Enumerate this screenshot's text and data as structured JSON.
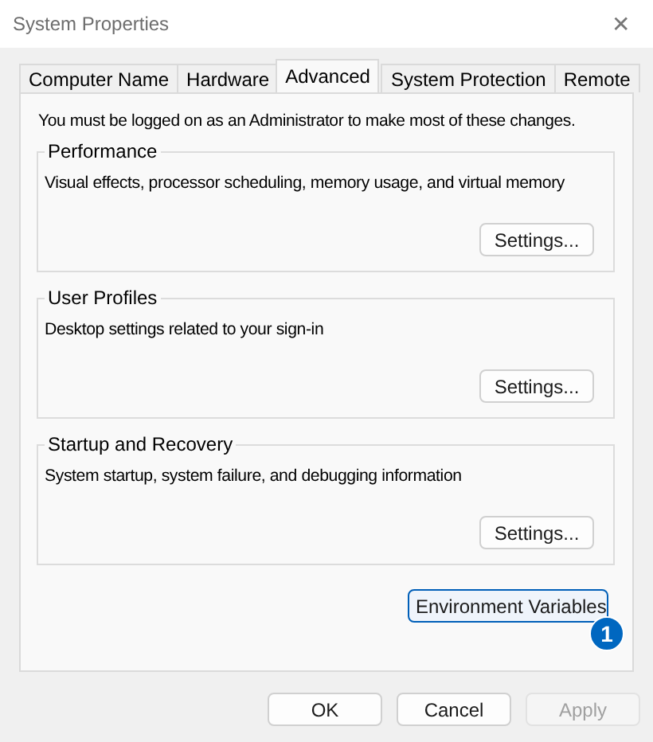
{
  "window": {
    "title": "System Properties",
    "close": "✕"
  },
  "tabs": [
    {
      "label": "Computer Name",
      "selected": false
    },
    {
      "label": "Hardware",
      "selected": false
    },
    {
      "label": "Advanced",
      "selected": true
    },
    {
      "label": "System Protection",
      "selected": false
    },
    {
      "label": "Remote",
      "selected": false
    }
  ],
  "notice": "You must be logged on as an Administrator to make most of these changes.",
  "groups": [
    {
      "title": "Performance",
      "description": "Visual effects, processor scheduling, memory usage, and virtual memory",
      "button": "Settings..."
    },
    {
      "title": "User Profiles",
      "description": "Desktop settings related to your sign-in",
      "button": "Settings..."
    },
    {
      "title": "Startup and Recovery",
      "description": "System startup, system failure, and debugging information",
      "button": "Settings..."
    }
  ],
  "environment_button": {
    "label": "Environment Variables",
    "focused": true
  },
  "callout": {
    "label": "1"
  },
  "buttons": [
    {
      "label": "OK",
      "disabled": false
    },
    {
      "label": "Cancel",
      "disabled": false
    },
    {
      "label": "Apply",
      "disabled": true
    }
  ]
}
